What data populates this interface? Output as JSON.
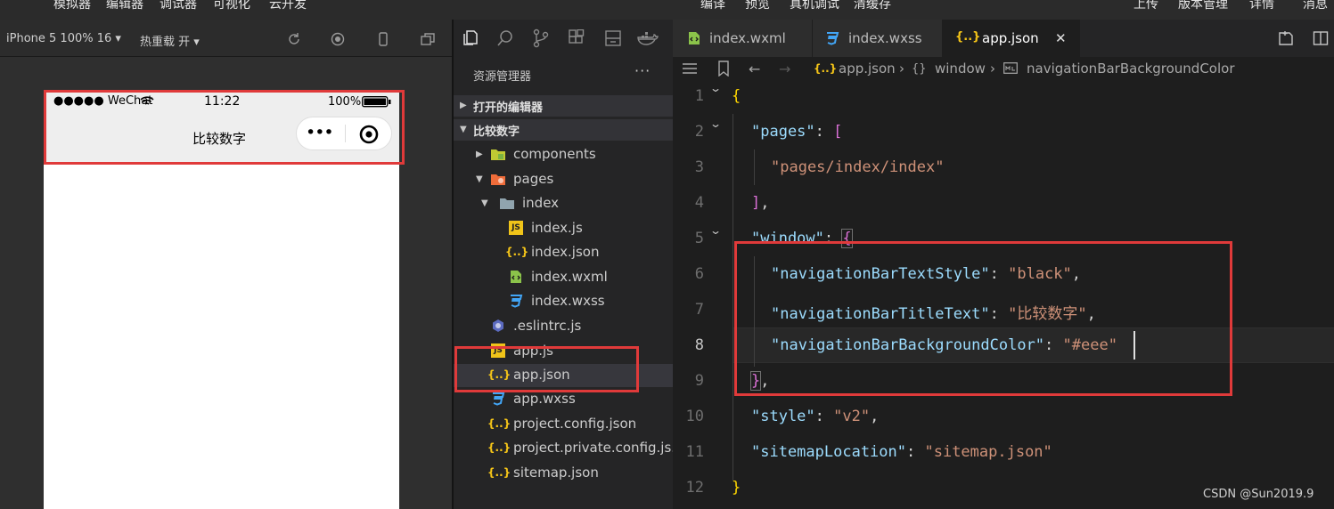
{
  "menubar": {
    "left": [
      "模拟器",
      "编辑器",
      "调试器",
      "可视化",
      "云开发"
    ],
    "center": [
      "编译",
      "预览",
      "真机调试",
      "清缓存"
    ],
    "right": [
      "上传",
      "版本管理",
      "详情",
      "消息"
    ]
  },
  "simulator": {
    "device_select": "iPhone 5 100% 16",
    "hot_reload": "热重载 开",
    "status_bar": {
      "carrier": "●●●●● WeChat",
      "time": "11:22",
      "battery": "100%"
    },
    "nav_title": "比较数字",
    "capsule_more": "•••",
    "navbar_bg": "#eeeeee"
  },
  "explorer": {
    "title": "资源管理器",
    "more": "···",
    "sections": [
      "打开的编辑器",
      "比较数字"
    ],
    "tree": [
      {
        "label": "components",
        "icon": "folder-components-icon"
      },
      {
        "label": "pages",
        "icon": "folder-pages-icon"
      },
      {
        "label": "index",
        "icon": "folder-icon"
      },
      {
        "label": "index.js",
        "icon": "js-file-icon"
      },
      {
        "label": "index.json",
        "icon": "json-file-icon"
      },
      {
        "label": "index.wxml",
        "icon": "wxml-file-icon"
      },
      {
        "label": "index.wxss",
        "icon": "wxss-file-icon"
      },
      {
        "label": ".eslintrc.js",
        "icon": "eslint-file-icon"
      },
      {
        "label": "app.js",
        "icon": "js-file-icon"
      },
      {
        "label": "app.json",
        "icon": "json-file-icon"
      },
      {
        "label": "app.wxss",
        "icon": "wxss-file-icon"
      },
      {
        "label": "project.config.json",
        "icon": "json-file-icon"
      },
      {
        "label": "project.private.config.js...",
        "icon": "json-file-icon"
      },
      {
        "label": "sitemap.json",
        "icon": "json-file-icon"
      }
    ],
    "selected": "app.json"
  },
  "editor": {
    "tabs": [
      {
        "label": "index.wxml",
        "icon": "wxml-file-icon"
      },
      {
        "label": "index.wxss",
        "icon": "wxss-file-icon"
      },
      {
        "label": "app.json",
        "icon": "json-file-icon",
        "close": "✕"
      }
    ],
    "breadcrumb": [
      "app.json",
      "window",
      "navigationBarBackgroundColor"
    ],
    "line_numbers": [
      "1",
      "2",
      "3",
      "4",
      "5",
      "6",
      "7",
      "8",
      "9",
      "10",
      "11",
      "12"
    ],
    "current_line": "8",
    "code": {
      "pages_key": "\"pages\"",
      "pages_value": "\"pages/index/index\"",
      "window_key": "\"window\"",
      "text_style_key": "\"navigationBarTextStyle\"",
      "text_style_value": "\"black\"",
      "title_key": "\"navigationBarTitleText\"",
      "title_value": "\"比较数字\"",
      "bg_key": "\"navigationBarBackgroundColor\"",
      "bg_value": "\"#eee\"",
      "style_key": "\"style\"",
      "style_value": "\"v2\"",
      "sitemap_key": "\"sitemapLocation\"",
      "sitemap_value": "\"sitemap.json\""
    }
  },
  "watermark": "CSDN @Sun2019.9",
  "colors": {
    "highlight_box": "#e03a3a",
    "json_key": "#9cdcfe",
    "json_string": "#ce9178",
    "brace": "#ffd700",
    "bracket": "#da70d6"
  }
}
